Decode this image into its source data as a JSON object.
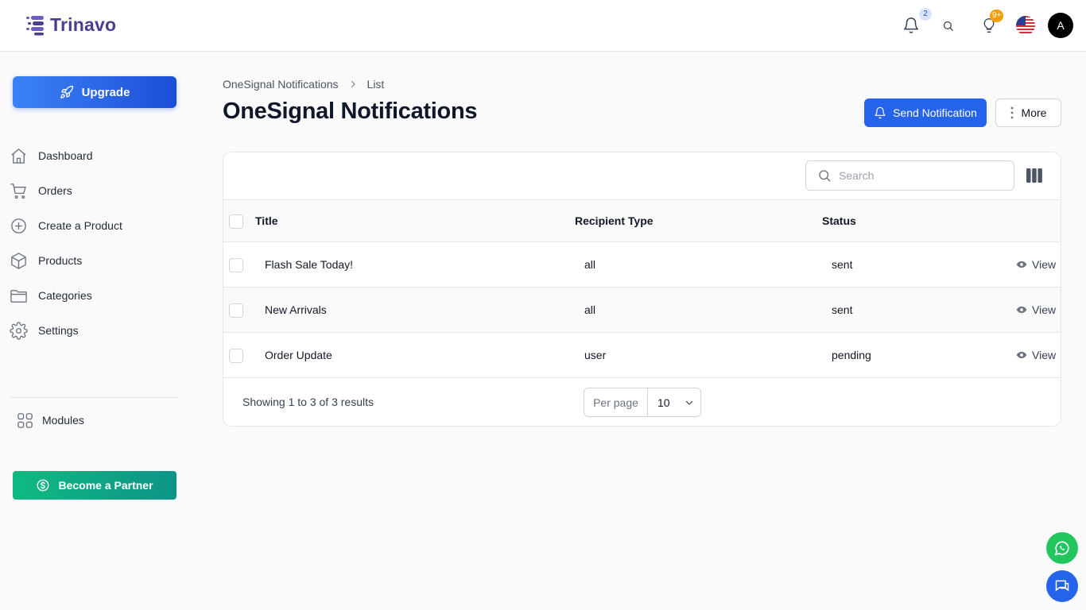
{
  "app": {
    "name": "Trinavo"
  },
  "header": {
    "notifications_badge": "2",
    "tips_badge": "9+",
    "avatar_initial": "A"
  },
  "sidebar": {
    "upgrade_label": "Upgrade",
    "items": [
      {
        "label": "Dashboard",
        "icon": "home-icon"
      },
      {
        "label": "Orders",
        "icon": "cart-icon"
      },
      {
        "label": "Create a Product",
        "icon": "plus-circle-icon"
      },
      {
        "label": "Products",
        "icon": "box-icon"
      },
      {
        "label": "Categories",
        "icon": "folder-icon"
      },
      {
        "label": "Settings",
        "icon": "gear-icon"
      }
    ],
    "modules_label": "Modules",
    "partner_label": "Become a Partner"
  },
  "breadcrumb": {
    "parent": "OneSignal Notifications",
    "current": "List"
  },
  "page": {
    "title": "OneSignal Notifications",
    "send_label": "Send Notification",
    "more_label": "More"
  },
  "table": {
    "search_placeholder": "Search",
    "columns": [
      "Title",
      "Recipient Type",
      "Status"
    ],
    "rows": [
      {
        "title": "Flash Sale Today!",
        "recipient": "all",
        "status": "sent",
        "action": "View"
      },
      {
        "title": "New Arrivals",
        "recipient": "all",
        "status": "sent",
        "action": "View"
      },
      {
        "title": "Order Update",
        "recipient": "user",
        "status": "pending",
        "action": "View"
      }
    ],
    "footer": {
      "summary": "Showing 1 to 3 of 3 results",
      "per_page_label": "Per page",
      "per_page_value": "10"
    }
  },
  "colors": {
    "primary": "#2563eb",
    "partner": "#10b981",
    "brand": "#4c3d8f",
    "whatsapp": "#22c55e"
  }
}
